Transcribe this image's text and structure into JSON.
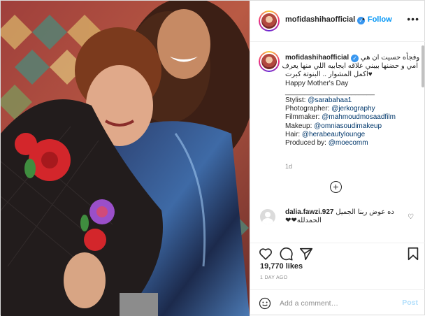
{
  "header": {
    "username": "mofidashihaofficial",
    "follow_label": "Follow",
    "more_label": "•••"
  },
  "caption": {
    "username": "mofidashihaofficial",
    "lines_ar": [
      "وفجأه حسيت ان هي",
      "امي و حضنها بيبني علاقه ايجابيه اللي منها يعرف",
      "اكمل المشوار .. البنوتة كبرت"
    ],
    "heart": "♥",
    "greeting": "Happy Mother's Day",
    "rule": "_______________________",
    "credits": [
      {
        "label": "Stylist: ",
        "handle": "@sarabahaa1"
      },
      {
        "label": "Photographer: ",
        "handle": "@jerkography"
      },
      {
        "label": "Filmmaker: ",
        "handle": "@mahmoudmosaadfilm"
      },
      {
        "label": "Makeup: ",
        "handle": "@omniasoudimakeup"
      },
      {
        "label": "Hair: ",
        "handle": "@herabeautylounge"
      },
      {
        "label": "Produced by: ",
        "handle": "@moecomm"
      }
    ],
    "time": "1d"
  },
  "load_more": "+",
  "comment": {
    "username": "dalia.fawzi.927",
    "text": "ده عوض ربنا الجميل",
    "text2": "الحمدلله",
    "hearts": "❤❤",
    "like_icon": "♡"
  },
  "stats": {
    "likes": "19,770 likes",
    "time_ago": "1 DAY AGO"
  },
  "add_comment": {
    "placeholder": "Add a comment…",
    "post_label": "Post"
  },
  "colors": {
    "accent": "#0095f6",
    "verified": "#3897f0",
    "post_disabled": "#b2dffc",
    "muted": "#8e8e8e"
  }
}
